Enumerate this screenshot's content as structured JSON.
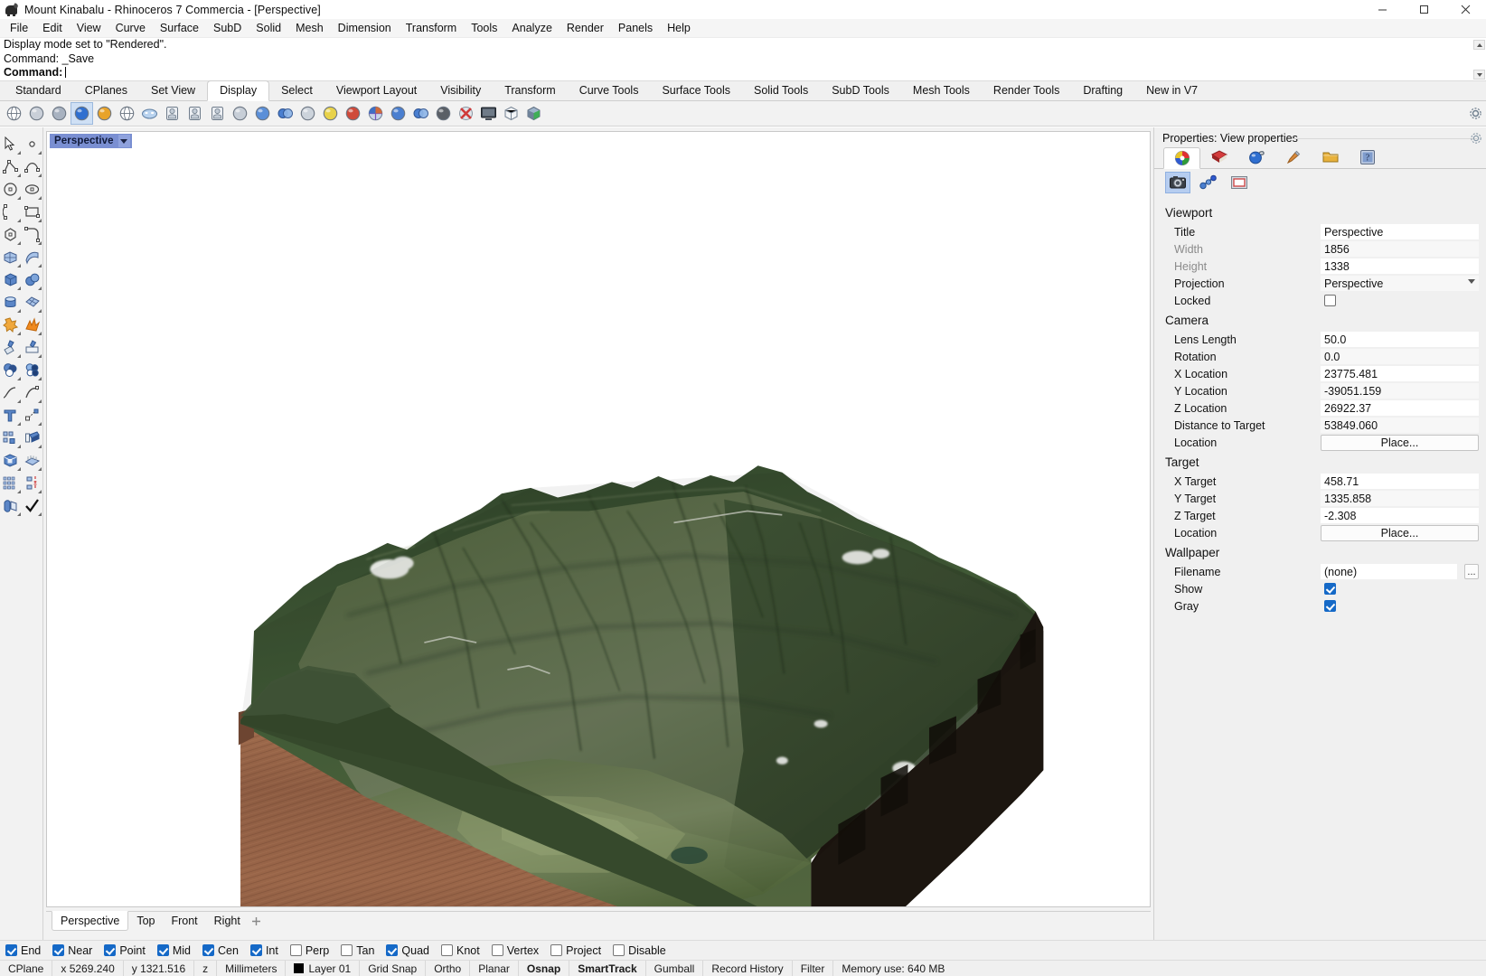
{
  "titlebar": {
    "title": "Mount Kinabalu - Rhinoceros 7 Commercia - [Perspective]",
    "app_icon": "rhino-icon",
    "minimize": "–",
    "maximize": "□",
    "close": "✕"
  },
  "menubar": {
    "items": [
      "File",
      "Edit",
      "View",
      "Curve",
      "Surface",
      "SubD",
      "Solid",
      "Mesh",
      "Dimension",
      "Transform",
      "Tools",
      "Analyze",
      "Render",
      "Panels",
      "Help"
    ]
  },
  "command_area": {
    "history": [
      "Display mode set to \"Rendered\".",
      "Command: _Save"
    ],
    "prompt": "Command:",
    "input_value": ""
  },
  "toolbar_tabs": {
    "items": [
      "Standard",
      "CPlanes",
      "Set View",
      "Display",
      "Select",
      "Viewport Layout",
      "Visibility",
      "Transform",
      "Curve Tools",
      "Surface Tools",
      "Solid Tools",
      "SubD Tools",
      "Mesh Tools",
      "Render Tools",
      "Drafting",
      "New in V7"
    ],
    "active": "Display"
  },
  "icon_toolbar": {
    "icons": [
      "wireframe-icon",
      "shaded-icon",
      "shaded-ghosted-icon",
      "rendered-icon",
      "arctic-icon",
      "wireframe-alt-icon",
      "xray-icon",
      "pen-icon",
      "technical-icon",
      "artistic-icon",
      "ghosted-icon",
      "raytraced-icon",
      "display-options-icon",
      "wireframe-sphere-icon",
      "shaded-sphere-icon",
      "gold-sphere-icon",
      "color-wheel-icon",
      "shade-selected-icon",
      "camera-sphere-icon",
      "flat-shade-icon",
      "no-display-icon",
      "fullscreen-icon",
      "box-edges-icon",
      "render-preview-icon"
    ],
    "selected_index": 3,
    "gear": "gear-icon"
  },
  "sidebar": {
    "icons": [
      [
        "select-arrow-icon",
        "point-icon"
      ],
      [
        "polyline-icon",
        "curve-icon"
      ],
      [
        "circle-icon",
        "ellipse-icon"
      ],
      [
        "arc-icon",
        "rectangle-icon"
      ],
      [
        "polygon-icon",
        "fillet-curve-icon"
      ],
      [
        "surface-from-points-icon",
        "surface-sweep-icon"
      ],
      [
        "box-icon",
        "sphere-icon"
      ],
      [
        "cylinder-icon",
        "surface-grid-icon"
      ],
      [
        "boolean-union-icon",
        "explode-icon"
      ],
      [
        "trim-icon",
        "split-icon"
      ],
      [
        "boolean-difference-icon",
        "boolean-intersection-icon"
      ],
      [
        "curve-blend-icon",
        "arc-blend-icon"
      ],
      [
        "text-icon",
        "scale-icon"
      ],
      [
        "array-icon",
        "extrude-icon"
      ],
      [
        "box-edit-icon",
        "mesh-from-surface-icon"
      ],
      [
        "grid-array-icon",
        "mirror-icon"
      ],
      [
        "unroll-icon",
        "check-icon"
      ]
    ]
  },
  "viewport": {
    "title": "Perspective",
    "dropdown_icon": "chevron-down-icon",
    "model_name": "Mount Kinabalu terrain block",
    "tabs": [
      "Perspective",
      "Top",
      "Front",
      "Right"
    ],
    "active_tab": "Perspective",
    "add_tab_icon": "add-viewport-icon"
  },
  "properties": {
    "title": "Properties: View properties",
    "gear_icon": "panel-options-icon",
    "tabs": [
      {
        "icon": "color-wheel-icon",
        "active": true
      },
      {
        "icon": "material-icon",
        "active": false
      },
      {
        "icon": "environment-icon",
        "active": false
      },
      {
        "icon": "paintbrush-icon",
        "active": false
      },
      {
        "icon": "folder-icon",
        "active": false
      },
      {
        "icon": "help-panel-icon",
        "active": false
      }
    ],
    "subtabs": [
      {
        "icon": "camera-icon",
        "active": true
      },
      {
        "icon": "linked-points-icon",
        "active": false
      },
      {
        "icon": "frame-icon",
        "active": false
      }
    ],
    "sections": [
      {
        "name": "Viewport",
        "rows": [
          {
            "label": "Title",
            "value": "Perspective",
            "type": "text",
            "dim": false
          },
          {
            "label": "Width",
            "value": "1856",
            "type": "text",
            "dim": true
          },
          {
            "label": "Height",
            "value": "1338",
            "type": "text",
            "dim": true
          },
          {
            "label": "Projection",
            "value": "Perspective",
            "type": "combo",
            "dim": false
          },
          {
            "label": "Locked",
            "value": "",
            "type": "checkbox",
            "checked": false,
            "dim": false
          }
        ]
      },
      {
        "name": "Camera",
        "rows": [
          {
            "label": "Lens Length",
            "value": "50.0",
            "type": "text",
            "dim": false
          },
          {
            "label": "Rotation",
            "value": "0.0",
            "type": "text",
            "dim": false
          },
          {
            "label": "X Location",
            "value": "23775.481",
            "type": "text",
            "dim": false
          },
          {
            "label": "Y Location",
            "value": "-39051.159",
            "type": "text",
            "dim": false
          },
          {
            "label": "Z Location",
            "value": "26922.37",
            "type": "text",
            "dim": false
          },
          {
            "label": "Distance to Target",
            "value": "53849.060",
            "type": "text",
            "dim": false
          },
          {
            "label": "Location",
            "value": "Place...",
            "type": "button",
            "dim": false
          }
        ]
      },
      {
        "name": "Target",
        "rows": [
          {
            "label": "X Target",
            "value": "458.71",
            "type": "text",
            "dim": false
          },
          {
            "label": "Y Target",
            "value": "1335.858",
            "type": "text",
            "dim": false
          },
          {
            "label": "Z Target",
            "value": "-2.308",
            "type": "text",
            "dim": false
          },
          {
            "label": "Location",
            "value": "Place...",
            "type": "button",
            "dim": false
          }
        ]
      },
      {
        "name": "Wallpaper",
        "rows": [
          {
            "label": "Filename",
            "value": "(none)",
            "type": "file",
            "dim": false,
            "browse": "..."
          },
          {
            "label": "Show",
            "value": "",
            "type": "checkbox",
            "checked": true,
            "dim": false
          },
          {
            "label": "Gray",
            "value": "",
            "type": "checkbox",
            "checked": true,
            "dim": false
          }
        ]
      }
    ]
  },
  "osnap": {
    "items": [
      {
        "label": "End",
        "checked": true
      },
      {
        "label": "Near",
        "checked": true
      },
      {
        "label": "Point",
        "checked": true
      },
      {
        "label": "Mid",
        "checked": true
      },
      {
        "label": "Cen",
        "checked": true
      },
      {
        "label": "Int",
        "checked": true
      },
      {
        "label": "Perp",
        "checked": false
      },
      {
        "label": "Tan",
        "checked": false
      },
      {
        "label": "Quad",
        "checked": true
      },
      {
        "label": "Knot",
        "checked": false
      },
      {
        "label": "Vertex",
        "checked": false
      },
      {
        "label": "Project",
        "checked": false
      },
      {
        "label": "Disable",
        "checked": false
      }
    ]
  },
  "statusbar": {
    "cplane": "CPlane",
    "x": "x 5269.240",
    "y": "y 1321.516",
    "z": "z",
    "units": "Millimeters",
    "layer": "Layer 01",
    "toggles": [
      {
        "label": "Grid Snap",
        "bold": false
      },
      {
        "label": "Ortho",
        "bold": false
      },
      {
        "label": "Planar",
        "bold": false
      },
      {
        "label": "Osnap",
        "bold": true
      },
      {
        "label": "SmartTrack",
        "bold": true
      },
      {
        "label": "Gumball",
        "bold": false
      },
      {
        "label": "Record History",
        "bold": false
      },
      {
        "label": "Filter",
        "bold": false
      }
    ],
    "memory": "Memory use: 640 MB"
  },
  "colors": {
    "accent_blue": "#1569c7",
    "viewport_title_bg": "#7a8fd2",
    "panel_bg": "#f0f0f0",
    "terrain_green": "#3e5536",
    "terrain_rock": "#8a5c45",
    "terrain_dark_side": "#1a1510"
  }
}
